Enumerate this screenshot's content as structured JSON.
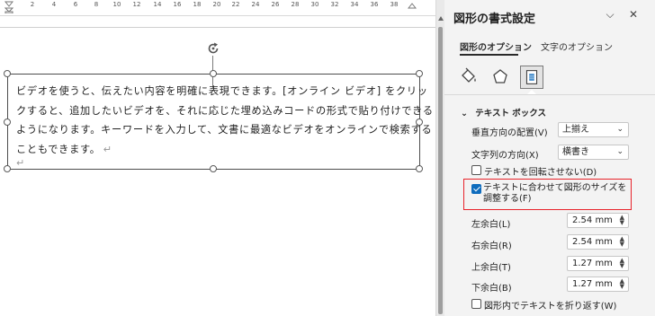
{
  "ruler": {
    "ticks": [
      "2",
      "4",
      "6",
      "8",
      "10",
      "12",
      "14",
      "16",
      "18",
      "20",
      "22",
      "24",
      "26",
      "28",
      "30",
      "32",
      "34",
      "36",
      "38"
    ]
  },
  "document": {
    "paragraph_lines": [
      "ビデオを使うと、伝えたい内容を明確に表現できます。[オンライン ビデオ] をクリッ",
      "クすると、追加したいビデオを、それに応じた埋め込みコードの形式で貼り付けできる",
      "ようになります。キーワードを入力して、文書に最適なビデオをオンラインで検索する",
      "こともできます。"
    ],
    "paragraph_mark": "↵",
    "empty_paragraph_mark": "↵"
  },
  "pane": {
    "title": "図形の書式設定",
    "collapse_glyph": "⌵",
    "close_glyph": "✕",
    "tabs": [
      "図形のオプション",
      "文字のオプション"
    ],
    "icon_tabs": [
      "fill-line-icon",
      "effects-icon",
      "layout-properties-icon"
    ],
    "section": {
      "chevron": "⌄",
      "title": "テキスト ボックス"
    },
    "vertical_alignment": {
      "label": "垂直方向の配置(V)",
      "value": "上揃え"
    },
    "text_direction": {
      "label": "文字列の方向(X)",
      "value": "横書き"
    },
    "no_rotate": {
      "label": "テキストを回転させない(D)",
      "checked": false
    },
    "autofit": {
      "label": "テキストに合わせて図形のサイズを調整する(F)",
      "checked": true
    },
    "margins": [
      {
        "label": "左余白(L)",
        "value": "2.54 mm"
      },
      {
        "label": "右余白(R)",
        "value": "2.54 mm"
      },
      {
        "label": "上余白(T)",
        "value": "1.27 mm"
      },
      {
        "label": "下余白(B)",
        "value": "1.27 mm"
      }
    ],
    "wrap": {
      "label": "図形内でテキストを折り返す(W)",
      "checked": false
    },
    "highlight_color": "#e8222a",
    "accent_color": "#0f6cbd"
  }
}
